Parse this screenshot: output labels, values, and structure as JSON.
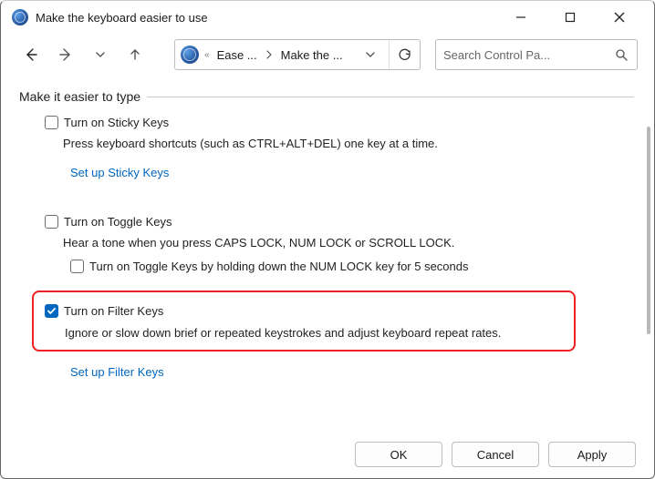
{
  "window": {
    "title": "Make the keyboard easier to use"
  },
  "address": {
    "crumb1": "Ease ...",
    "crumb2": "Make the ..."
  },
  "search": {
    "placeholder": "Search Control Pa..."
  },
  "section": {
    "heading": "Make it easier to type",
    "sticky": {
      "label": "Turn on Sticky Keys",
      "desc": "Press keyboard shortcuts (such as CTRL+ALT+DEL) one key at a time.",
      "link": "Set up Sticky Keys",
      "checked": false
    },
    "toggle": {
      "label": "Turn on Toggle Keys",
      "desc": "Hear a tone when you press CAPS LOCK, NUM LOCK or SCROLL LOCK.",
      "sub_label": "Turn on Toggle Keys by holding down the NUM LOCK key for 5 seconds",
      "checked": false,
      "sub_checked": false
    },
    "filter": {
      "label": "Turn on Filter Keys",
      "desc": "Ignore or slow down brief or repeated keystrokes and adjust keyboard repeat rates.",
      "link": "Set up Filter Keys",
      "checked": true
    }
  },
  "buttons": {
    "ok": "OK",
    "cancel": "Cancel",
    "apply": "Apply"
  }
}
